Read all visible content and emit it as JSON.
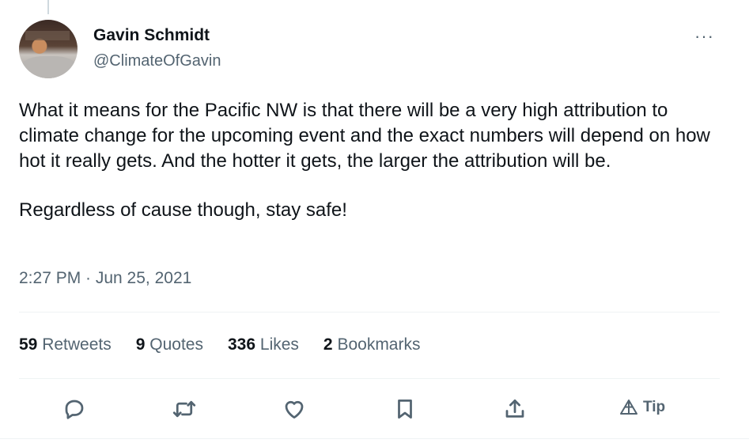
{
  "author": {
    "name": "Gavin Schmidt",
    "handle": "@ClimateOfGavin"
  },
  "tweet": {
    "paragraph1": "What it means for the Pacific NW is that there will be a very high attribution to climate change for the upcoming event and the exact numbers will depend on how hot it really gets. And the hotter it gets, the larger the attribution will be.",
    "paragraph2": "Regardless of cause though, stay safe!",
    "timestamp": "2:27 PM · Jun 25, 2021"
  },
  "stats": {
    "retweets_count": "59",
    "retweets_label": "Retweets",
    "quotes_count": "9",
    "quotes_label": "Quotes",
    "likes_count": "336",
    "likes_label": "Likes",
    "bookmarks_count": "2",
    "bookmarks_label": "Bookmarks"
  },
  "actions": {
    "more_label": "···",
    "tip_label": "Tip",
    "icons": [
      "reply-icon",
      "retweet-icon",
      "like-icon",
      "bookmark-icon",
      "share-icon",
      "tip-icon"
    ]
  },
  "colors": {
    "text": "#0f1419",
    "secondary": "#536471",
    "divider": "#eff3f4"
  }
}
